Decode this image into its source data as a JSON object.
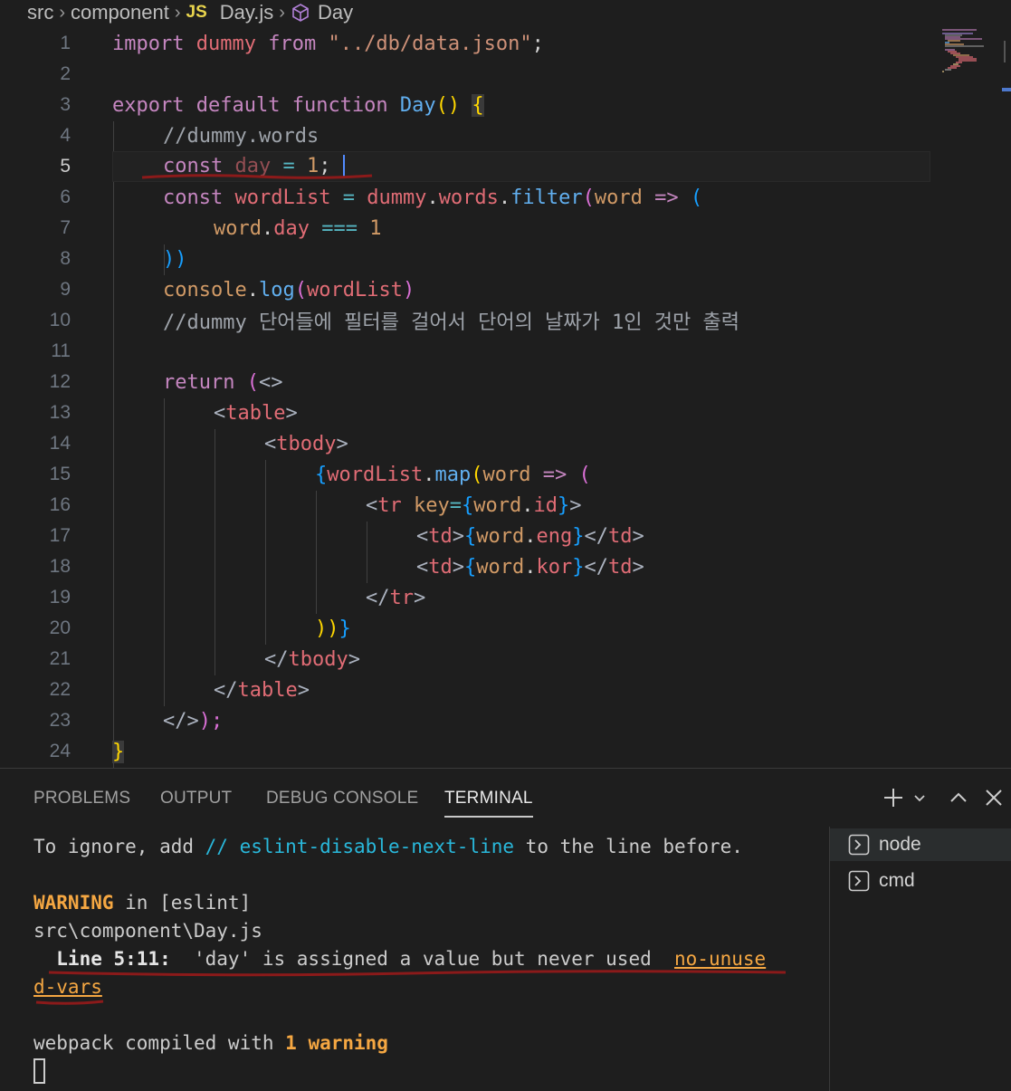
{
  "breadcrumb": {
    "items": [
      "src",
      "component",
      "Day.js",
      "Day"
    ],
    "js_badge": "JS"
  },
  "editor": {
    "line_numbers": [
      "1",
      "2",
      "3",
      "4",
      "5",
      "6",
      "7",
      "8",
      "9",
      "10",
      "11",
      "12",
      "13",
      "14",
      "15",
      "16",
      "17",
      "18",
      "19",
      "20",
      "21",
      "22",
      "23",
      "24"
    ],
    "current_line": 5,
    "lines": {
      "l1": [
        "import",
        " ",
        "dummy",
        " ",
        "from",
        " ",
        "\"../db/data.json\"",
        ";"
      ],
      "l3": [
        "export",
        " ",
        "default",
        " ",
        "function",
        " ",
        "Day",
        "()",
        " ",
        "{"
      ],
      "l4": [
        "//dummy.words"
      ],
      "l5": [
        "const",
        " ",
        "day",
        " = ",
        "1",
        ";"
      ],
      "l6": [
        "const",
        " ",
        "wordList",
        " = ",
        "dummy",
        ".",
        "words",
        ".",
        "filter",
        "(",
        "word",
        " => ",
        "("
      ],
      "l7": [
        "word",
        ".",
        "day",
        " === ",
        "1"
      ],
      "l8": [
        "))"
      ],
      "l9": [
        "console",
        ".",
        "log",
        "(",
        "wordList",
        ")"
      ],
      "l10": [
        "//dummy 단어들에 필터를 걸어서 단어의 날짜가 1인 것만 출력"
      ],
      "l12": [
        "return",
        " (",
        "<>"
      ],
      "l13": [
        "<",
        "table",
        ">"
      ],
      "l14": [
        "<",
        "tbody",
        ">"
      ],
      "l15": [
        "{",
        "wordList",
        ".",
        "map",
        "(",
        "word",
        " => ",
        "("
      ],
      "l16": [
        "<",
        "tr",
        " ",
        "key",
        "=",
        "{",
        "word",
        ".",
        "id",
        "}",
        ">"
      ],
      "l17": [
        "<",
        "td",
        ">",
        "{",
        "word",
        ".",
        "eng",
        "}",
        "</",
        "td",
        ">"
      ],
      "l18": [
        "<",
        "td",
        ">",
        "{",
        "word",
        ".",
        "kor",
        "}",
        "</",
        "td",
        ">"
      ],
      "l19": [
        "</",
        "tr",
        ">"
      ],
      "l20": [
        "))",
        "}"
      ],
      "l21": [
        "</",
        "tbody",
        ">"
      ],
      "l22": [
        "</",
        "table",
        ">"
      ],
      "l23": [
        "</>",
        ");"
      ],
      "l24": [
        "}"
      ]
    }
  },
  "panel": {
    "tabs": [
      "PROBLEMS",
      "OUTPUT",
      "DEBUG CONSOLE",
      "TERMINAL"
    ],
    "active_tab": "TERMINAL",
    "terminal": {
      "line1_a": "To ignore, add ",
      "line1_b": "// eslint-disable-next-line",
      "line1_c": " to the line before.",
      "warning_label": "WARNING",
      "warning_rest": " in [eslint]",
      "file_path": "src\\component\\Day.js",
      "loc": "  Line 5:11:",
      "message": "  'day' is assigned a value but never used  ",
      "rule_part1": "no-unuse",
      "rule_part2": "d-vars",
      "compiled_a": "webpack compiled with ",
      "compiled_b": "1 warning"
    },
    "terminals": [
      "node",
      "cmd"
    ]
  },
  "colors": {
    "background": "#1e1e1e",
    "keyword": "#c586c0",
    "variable": "#e06c75",
    "string": "#ce9178",
    "warning": "#f5a742",
    "annotation_underline": "#8b1a1a"
  }
}
